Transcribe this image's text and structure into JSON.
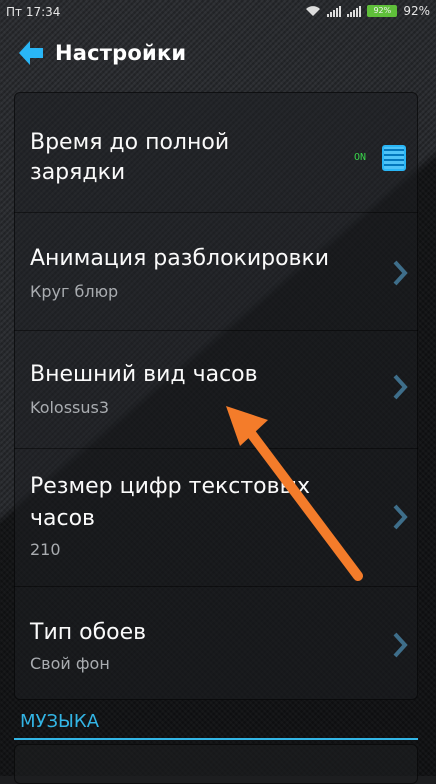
{
  "status_bar": {
    "time": "Пт 17:34",
    "battery_percent": "92%",
    "battery_label": "92%"
  },
  "app_bar": {
    "title": "Настройки"
  },
  "settings": [
    {
      "title_line1": "Время до полной",
      "title_line2": "зарядки",
      "toggle": "ON"
    },
    {
      "title": "Анимация разблокировки",
      "subtitle": "Круг блюр"
    },
    {
      "title": "Внешний вид часов",
      "subtitle": "Kolossus3"
    },
    {
      "title_line1": "Резмер цифр текстовых",
      "title_line2": "часов",
      "subtitle": "210"
    },
    {
      "title": "Тип обоев",
      "subtitle": "Свой фон"
    }
  ],
  "section": {
    "label": "МУЗЫКА"
  },
  "colors": {
    "accent": "#33b5e5",
    "annotation_arrow": "#f47c2a",
    "toggle_on": "#38d64b"
  }
}
